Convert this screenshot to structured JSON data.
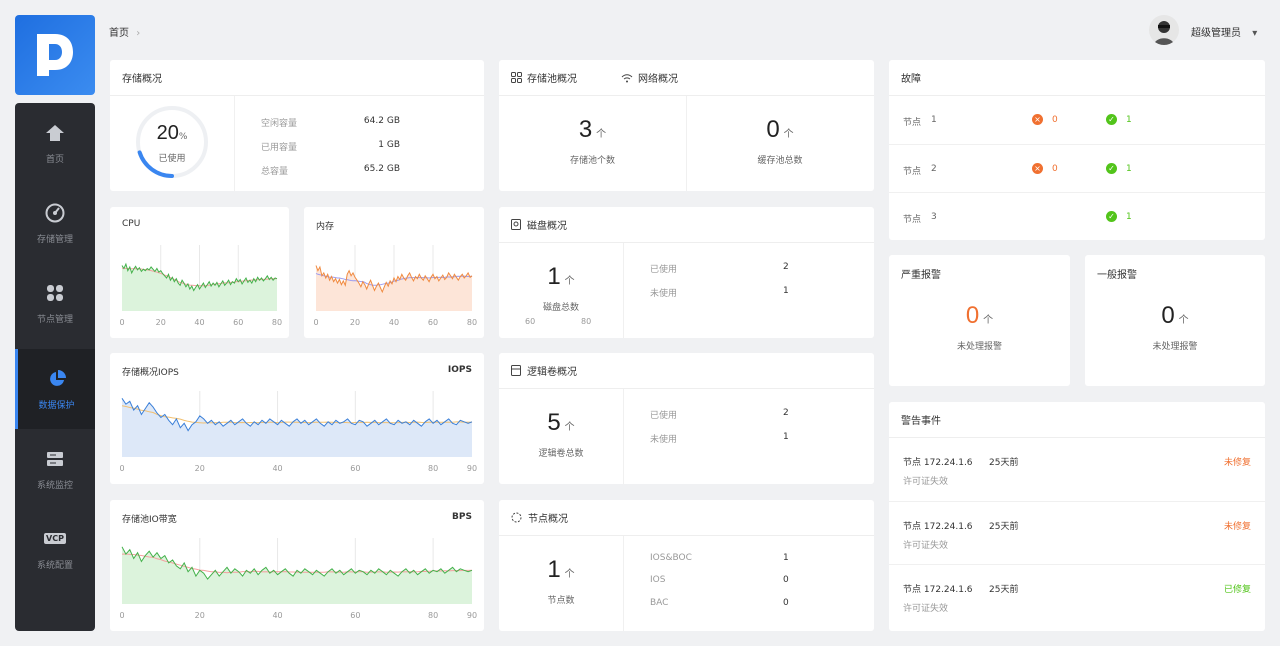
{
  "breadcrumb": {
    "label": "首页",
    "separator": "›"
  },
  "user": {
    "name": "超级管理员",
    "caret": "▾"
  },
  "sidebar": {
    "items": [
      {
        "label": "首页",
        "icon": "home-icon"
      },
      {
        "label": "存储管理",
        "icon": "gauge-icon"
      },
      {
        "label": "节点管理",
        "icon": "nodes-icon"
      },
      {
        "label": "数据保护",
        "icon": "pie-icon"
      },
      {
        "label": "系统监控",
        "icon": "server-icon"
      },
      {
        "label": "系统配置",
        "icon": "vcp-icon"
      }
    ],
    "active_index": 3,
    "vcp_text": "VCP"
  },
  "storage_overview": {
    "title": "存储概况",
    "percent": "20",
    "percent_sign": "%",
    "used_label": "已使用",
    "used_fraction": 0.2,
    "rows": [
      {
        "label": "空闲容量",
        "value": "64.2",
        "unit": "GB"
      },
      {
        "label": "已用容量",
        "value": "1",
        "unit": "GB"
      },
      {
        "label": "总容量",
        "value": "65.2",
        "unit": "GB"
      }
    ]
  },
  "pool_overview": {
    "tab1": "存储池概况",
    "tab2": "网络概况",
    "pool_count": "3",
    "pool_unit": "个",
    "pool_label": "存储池个数",
    "cache_count": "0",
    "cache_unit": "个",
    "cache_label": "缓存池总数"
  },
  "fault": {
    "title": "故障",
    "rows": [
      {
        "label": "节点",
        "num": "1",
        "err": "0",
        "ok": "1",
        "has_err": true
      },
      {
        "label": "节点",
        "num": "2",
        "err": "0",
        "ok": "1",
        "has_err": true
      },
      {
        "label": "节点",
        "num": "3",
        "err": "",
        "ok": "1",
        "has_err": false
      }
    ],
    "err_glyph": "×",
    "ok_glyph": "✓"
  },
  "disk": {
    "title": "磁盘概况",
    "total": "1",
    "unit": "个",
    "label": "磁盘总数",
    "axis": [
      "60",
      "80"
    ],
    "rows": [
      {
        "label": "已使用",
        "value": "2"
      },
      {
        "label": "未使用",
        "value": "1"
      }
    ]
  },
  "lvm": {
    "title": "逻辑卷概况",
    "total": "5",
    "unit": "个",
    "label": "逻辑卷总数",
    "rows": [
      {
        "label": "已使用",
        "value": "2"
      },
      {
        "label": "未使用",
        "value": "1"
      }
    ]
  },
  "node": {
    "title": "节点概况",
    "total": "1",
    "unit": "个",
    "label": "节点数",
    "rows": [
      {
        "label": "IOS&BOC",
        "value": "1"
      },
      {
        "label": "IOS",
        "value": "0"
      },
      {
        "label": "BAC",
        "value": "0"
      }
    ]
  },
  "severe_alarm": {
    "title": "严重报警",
    "value": "0",
    "unit": "个",
    "label": "未处理报警"
  },
  "normal_alarm": {
    "title": "一般报警",
    "value": "0",
    "unit": "个",
    "label": "未处理报警"
  },
  "events": {
    "title": "警告事件",
    "items": [
      {
        "node": "节点 172.24.1.6",
        "time": "25天前",
        "desc": "许可证失效",
        "status": "未修复",
        "status_color": "#f07030"
      },
      {
        "node": "节点 172.24.1.6",
        "time": "25天前",
        "desc": "许可证失效",
        "status": "未修复",
        "status_color": "#f07030"
      },
      {
        "node": "节点 172.24.1.6",
        "time": "25天前",
        "desc": "许可证失效",
        "status": "已修复",
        "status_color": "#52c41a"
      }
    ]
  },
  "colors": {
    "accent": "#3a86f0",
    "orange": "#f07030",
    "green": "#52c41a",
    "sidebar": "#2a2c31"
  },
  "chart_data": [
    {
      "type": "area",
      "title": "CPU",
      "xlim": [
        0,
        80
      ],
      "x_ticks": [
        "0",
        "20",
        "40",
        "60",
        "80"
      ],
      "color": "#43b14a",
      "fill": "#dcf3dc",
      "avg_color": "#f5a0a0",
      "values": [
        62,
        58,
        64,
        55,
        60,
        52,
        57,
        61,
        56,
        59,
        54,
        57,
        55,
        58,
        56,
        60,
        57,
        54,
        58,
        53,
        55,
        51,
        48,
        45,
        50,
        42,
        46,
        40,
        44,
        38,
        35,
        42,
        38,
        33,
        37,
        30,
        34,
        28,
        32,
        36,
        30,
        34,
        38,
        32,
        36,
        40,
        34,
        38,
        35,
        39,
        33,
        37,
        41,
        35,
        38,
        42,
        36,
        40,
        38,
        44,
        40,
        43,
        37,
        41,
        45,
        39,
        42,
        38,
        44,
        40,
        46,
        42,
        45,
        41,
        44,
        48,
        43,
        46,
        42,
        45,
        44
      ]
    },
    {
      "type": "area",
      "title": "内存",
      "xlim": [
        0,
        80
      ],
      "x_ticks": [
        "0",
        "20",
        "40",
        "60",
        "80"
      ],
      "color": "#f08a40",
      "fill": "#fde5d8",
      "avg_color": "#9e9ef0",
      "values": [
        62,
        55,
        60,
        48,
        52,
        45,
        50,
        42,
        47,
        40,
        44,
        38,
        43,
        36,
        41,
        35,
        50,
        55,
        48,
        52,
        46,
        42,
        38,
        33,
        40,
        36,
        30,
        37,
        42,
        35,
        28,
        34,
        38,
        32,
        26,
        33,
        39,
        34,
        41,
        37,
        45,
        40,
        47,
        43,
        50,
        45,
        42,
        48,
        52,
        46,
        41,
        47,
        44,
        50,
        45,
        42,
        48,
        44,
        40,
        46,
        50,
        44,
        47,
        41,
        45,
        49,
        43,
        46,
        52,
        48,
        44,
        50,
        46,
        42,
        47,
        50,
        45,
        48,
        52,
        46,
        48
      ]
    },
    {
      "type": "area",
      "title": "存储概况IOPS",
      "units": "IOPS",
      "xlim": [
        0,
        90
      ],
      "x_ticks": [
        "0",
        "20",
        "40",
        "60",
        "80",
        "90"
      ],
      "color": "#3a7fd8",
      "fill": "#dde8f8",
      "avg_color": "#f2c070",
      "values": [
        80,
        72,
        76,
        64,
        70,
        58,
        66,
        74,
        68,
        60,
        54,
        58,
        50,
        44,
        52,
        40,
        46,
        36,
        44,
        48,
        56,
        52,
        46,
        50,
        44,
        48,
        42,
        46,
        50,
        44,
        48,
        52,
        46,
        42,
        48,
        44,
        50,
        46,
        52,
        48,
        44,
        50,
        46,
        42,
        48,
        52,
        46,
        50,
        44,
        48,
        52,
        46,
        42,
        48,
        44,
        50,
        46,
        48,
        52,
        46,
        44,
        50,
        48,
        42,
        46,
        50,
        44,
        48,
        52,
        46,
        44,
        50,
        46,
        48,
        44,
        50,
        46,
        42,
        48,
        52,
        46,
        50,
        44,
        48,
        52,
        46,
        44,
        50,
        48,
        46,
        48
      ]
    },
    {
      "type": "area",
      "title": "存储池IO带宽",
      "units": "BPS",
      "xlim": [
        0,
        90
      ],
      "x_ticks": [
        "0",
        "20",
        "40",
        "60",
        "80",
        "90"
      ],
      "color": "#43b14a",
      "fill": "#dcf3dc",
      "avg_color": "#f5a0a0",
      "values": [
        78,
        68,
        74,
        62,
        70,
        58,
        66,
        72,
        64,
        70,
        62,
        66,
        56,
        60,
        52,
        48,
        56,
        44,
        50,
        38,
        46,
        42,
        34,
        40,
        46,
        38,
        44,
        50,
        42,
        48,
        44,
        38,
        46,
        42,
        48,
        40,
        46,
        50,
        42,
        46,
        40,
        44,
        48,
        42,
        38,
        46,
        42,
        48,
        44,
        40,
        46,
        42,
        38,
        44,
        48,
        42,
        46,
        40,
        44,
        48,
        42,
        46,
        44,
        40,
        46,
        42,
        48,
        44,
        40,
        46,
        42,
        38,
        44,
        48,
        42,
        46,
        40,
        44,
        48,
        42,
        46,
        44,
        48,
        42,
        46,
        50,
        44,
        48,
        46,
        44,
        46
      ]
    }
  ]
}
